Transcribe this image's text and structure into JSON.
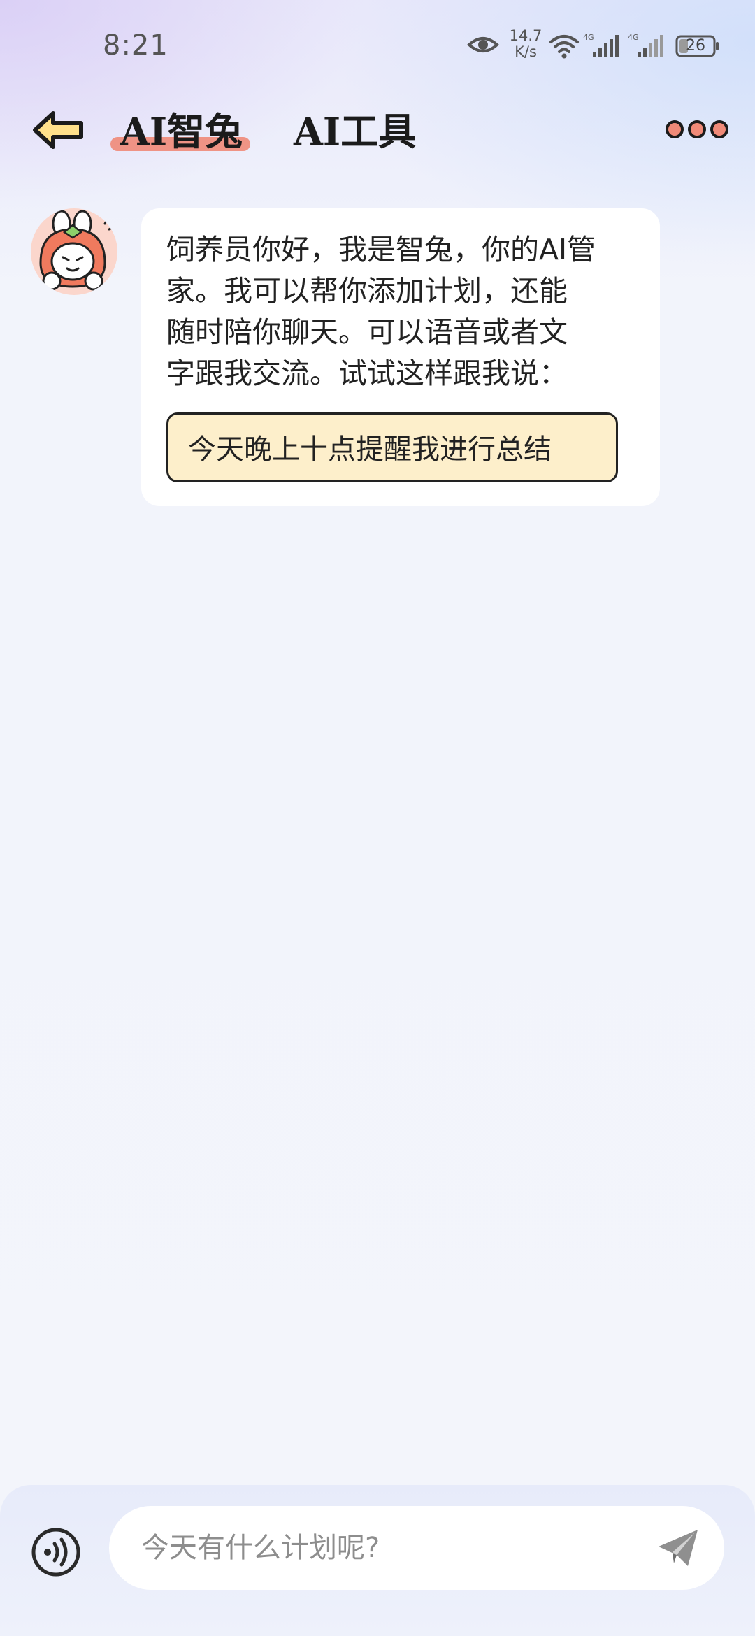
{
  "status_bar": {
    "time": "8:21",
    "net_speed_value": "14.7",
    "net_speed_unit": "K/s",
    "sim1_label": "4G",
    "sim2_label": "4G",
    "battery": "26",
    "icons": [
      "eye-icon",
      "wifi-icon",
      "signal-icon",
      "signal-icon",
      "battery-icon"
    ]
  },
  "header": {
    "back_icon": "arrow-left-icon",
    "tabs": [
      {
        "label": "AI智兔",
        "active": true
      },
      {
        "label": "AI工具",
        "active": false
      }
    ],
    "more_icon": "more-dots-icon",
    "accent_color": "#f08a78"
  },
  "chat": {
    "messages": [
      {
        "sender": "assistant",
        "avatar_icon": "rabbit-avatar-icon",
        "lines": [
          "饲养员你好，我是智兔，你的AI管",
          "家。我可以帮你添加计划，还能",
          "随时陪你聊天。可以语音或者文",
          "字跟我交流。试试这样跟我说："
        ],
        "suggestion": "今天晚上十点提醒我进行总结"
      }
    ]
  },
  "input_bar": {
    "voice_icon": "voice-icon",
    "placeholder": "今天有什么计划呢?",
    "send_icon": "send-icon"
  }
}
